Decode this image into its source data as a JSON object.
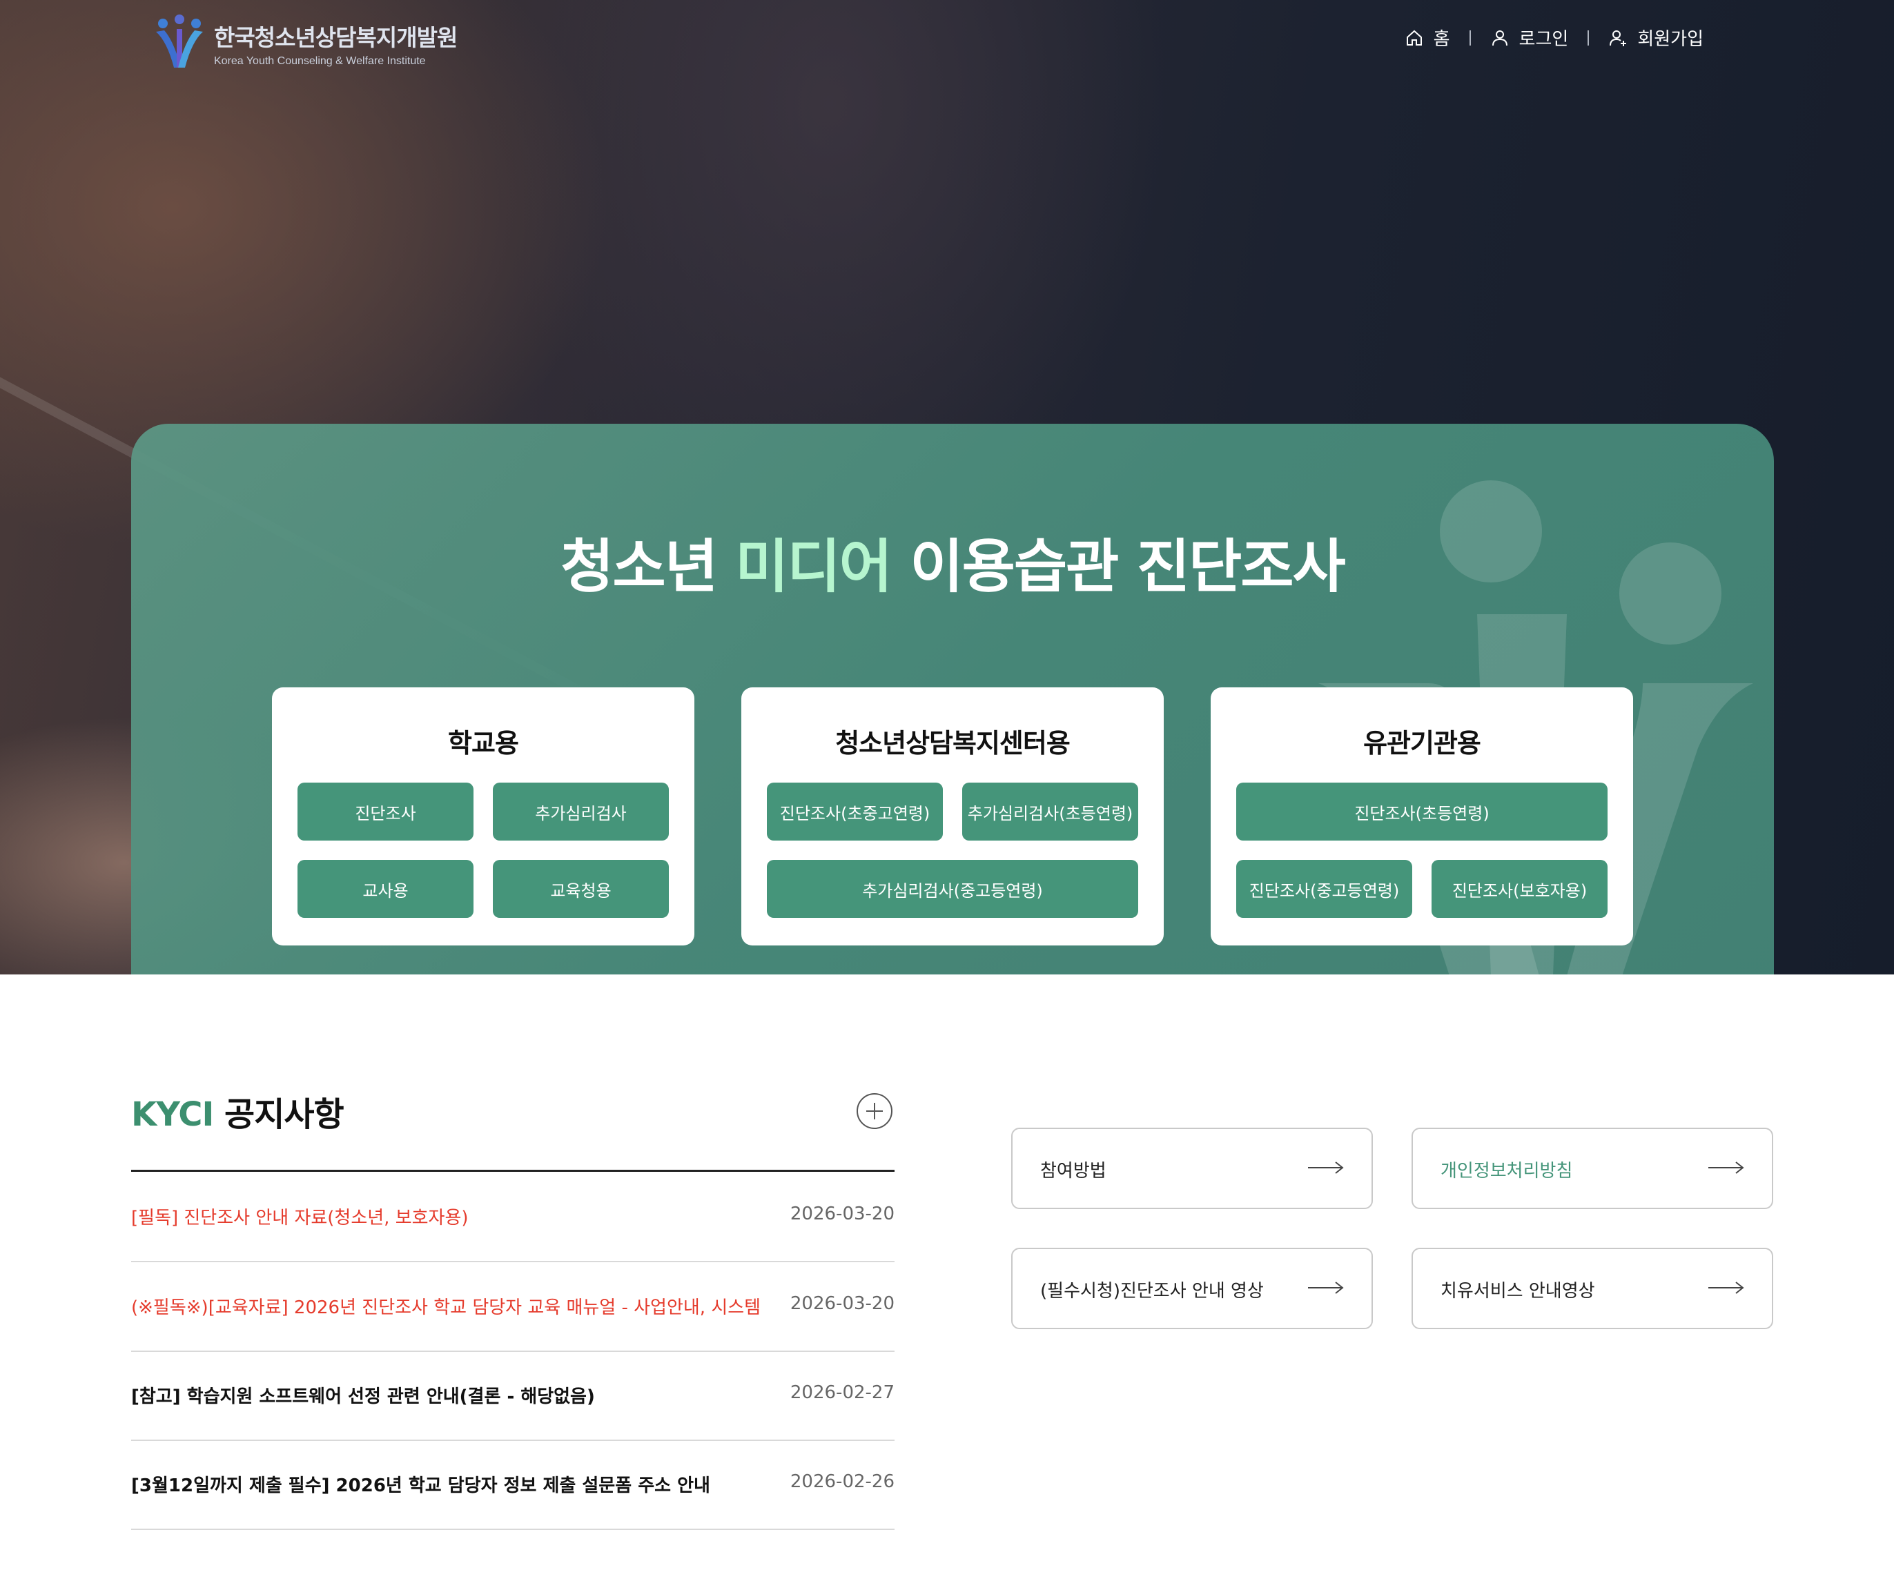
{
  "header": {
    "logo_ko": "한국청소년상담복지개발원",
    "logo_en": "Korea Youth Counseling & Welfare Institute",
    "nav": [
      {
        "label": "홈",
        "icon": "home-icon"
      },
      {
        "label": "로그인",
        "icon": "user-icon"
      },
      {
        "label": "회원가입",
        "icon": "user-add-icon"
      }
    ]
  },
  "hero": {
    "title_before": "청소년 ",
    "title_accent": "미디어",
    "title_after": " 이용습관 진단조사",
    "accent_color": "#b6f5cf",
    "cards": [
      {
        "title": "학교용",
        "buttons": [
          "진단조사",
          "추가심리검사",
          "교사용",
          "교육청용"
        ]
      },
      {
        "title": "청소년상담복지센터용",
        "buttons": [
          "진단조사(초중고연령)",
          "추가심리검사(초등연령)",
          "추가심리검사(중고등연령)"
        ]
      },
      {
        "title": "유관기관용",
        "buttons": [
          "진단조사(초등연령)",
          "진단조사(중고등연령)",
          "진단조사(보호자용)"
        ]
      }
    ]
  },
  "notice": {
    "title_en": "KYCI",
    "title_ko": " 공지사항",
    "more_icon": "plus-circle-icon",
    "items": [
      {
        "title": "[필독] 진단조사 안내 자료(청소년, 보호자용)",
        "date": "2026-03-20",
        "style": "red"
      },
      {
        "title": "(※필독※)[교육자료] 2026년 진단조사 학교 담당자 교육 매뉴얼 - 사업안내, 시스템",
        "date": "2026-03-20",
        "style": "red"
      },
      {
        "title": "[참고] 학습지원 소프트웨어 선정 관련 안내(결론 - 해당없음)",
        "date": "2026-02-27",
        "style": "dark"
      },
      {
        "title": "[3월12일까지 제출 필수] 2026년 학교 담당자 정보 제출 설문폼 주소 안내",
        "date": "2026-02-26",
        "style": "dark"
      }
    ]
  },
  "quick_links": [
    {
      "label": "참여방법",
      "icon": "arrow-right-icon"
    },
    {
      "label": "개인정보처리방침",
      "icon": "arrow-right-icon"
    },
    {
      "label": "(필수시청)진단조사 안내 영상",
      "icon": "arrow-right-icon"
    },
    {
      "label": "치유서비스 안내영상",
      "icon": "arrow-right-icon"
    }
  ],
  "colors": {
    "primary": "#45957a",
    "notice_accent": "#3c8f6f",
    "alert": "#e53b2c"
  }
}
